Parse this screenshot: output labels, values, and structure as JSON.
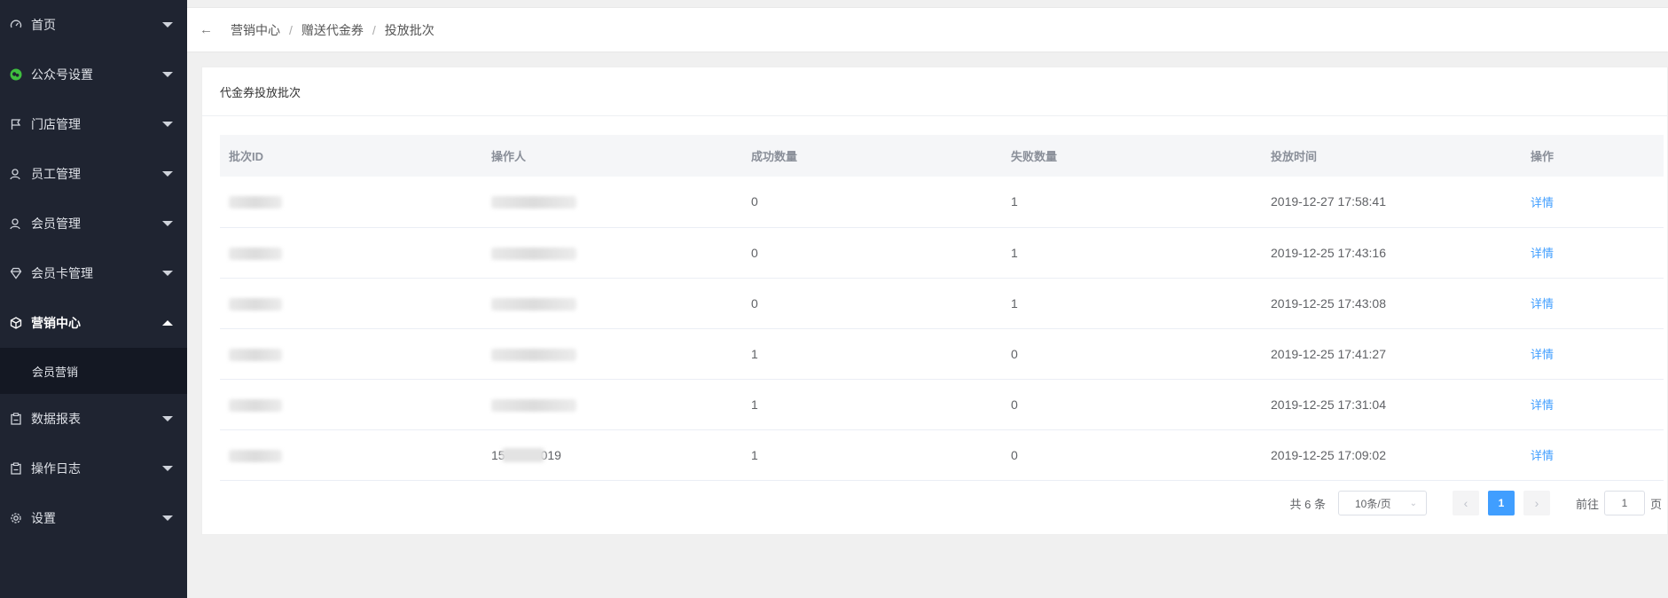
{
  "sidebar": {
    "items": [
      {
        "label": "首页",
        "icon": "gauge-icon"
      },
      {
        "label": "公众号设置",
        "icon": "wechat-icon"
      },
      {
        "label": "门店管理",
        "icon": "flag-icon"
      },
      {
        "label": "员工管理",
        "icon": "user-icon"
      },
      {
        "label": "会员管理",
        "icon": "user-icon"
      },
      {
        "label": "会员卡管理",
        "icon": "diamond-icon"
      },
      {
        "label": "营销中心",
        "icon": "box-icon",
        "active": true
      },
      {
        "label": "数据报表",
        "icon": "clipboard-icon"
      },
      {
        "label": "操作日志",
        "icon": "clipboard-icon"
      },
      {
        "label": "设置",
        "icon": "gear-icon"
      }
    ],
    "submenu": {
      "label": "会员营销"
    }
  },
  "breadcrumb": {
    "back_icon": "arrow-left-icon",
    "items": [
      "营销中心",
      "赠送代金券",
      "投放批次"
    ],
    "separator": "/"
  },
  "card": {
    "title": "代金券投放批次"
  },
  "table": {
    "headers": [
      "批次ID",
      "操作人",
      "成功数量",
      "失败数量",
      "投放时间",
      "操作"
    ],
    "rows": [
      {
        "success": "0",
        "fail": "1",
        "time": "2019-12-27 17:58:41",
        "action": "详情"
      },
      {
        "success": "0",
        "fail": "1",
        "time": "2019-12-25 17:43:16",
        "action": "详情"
      },
      {
        "success": "0",
        "fail": "1",
        "time": "2019-12-25 17:43:08",
        "action": "详情"
      },
      {
        "success": "1",
        "fail": "0",
        "time": "2019-12-25 17:41:27",
        "action": "详情"
      },
      {
        "success": "1",
        "fail": "0",
        "time": "2019-12-25 17:31:04",
        "action": "详情"
      },
      {
        "success": "1",
        "fail": "0",
        "time": "2019-12-25 17:09:02",
        "action": "详情",
        "operator_prefix": "15",
        "operator_suffix": "019"
      }
    ]
  },
  "pagination": {
    "total": "共 6 条",
    "page_size": "10条/页",
    "current_page": "1",
    "goto_label": "前往",
    "goto_value": "1",
    "goto_suffix": "页"
  },
  "colors": {
    "sidebar_bg": "#1f2431",
    "accent": "#409eff",
    "wechat_green": "#3fbf3f"
  }
}
